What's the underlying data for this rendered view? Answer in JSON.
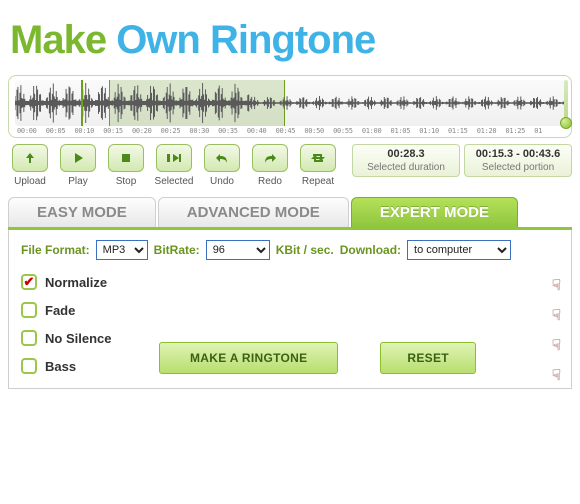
{
  "title": {
    "w1": "Make",
    "w2": "Own",
    "w3": "Ringtone"
  },
  "waveform": {
    "ticks": [
      "00:00",
      "00:05",
      "00:10",
      "00:15",
      "00:20",
      "00:25",
      "00:30",
      "00:35",
      "00:40",
      "00:45",
      "00:50",
      "00:55",
      "01:00",
      "01:05",
      "01:10",
      "01:15",
      "01:20",
      "01:25",
      "01"
    ],
    "cursor_pct": 12,
    "sel_start_pct": 17,
    "sel_end_pct": 49
  },
  "toolbar": [
    {
      "name": "upload",
      "label": "Upload",
      "icon": "upload"
    },
    {
      "name": "play",
      "label": "Play",
      "icon": "play"
    },
    {
      "name": "stop",
      "label": "Stop",
      "icon": "stop"
    },
    {
      "name": "selected",
      "label": "Selected",
      "icon": "selected"
    },
    {
      "name": "undo",
      "label": "Undo",
      "icon": "undo"
    },
    {
      "name": "redo",
      "label": "Redo",
      "icon": "redo"
    },
    {
      "name": "repeat",
      "label": "Repeat",
      "icon": "repeat"
    }
  ],
  "stats": {
    "duration": {
      "value": "00:28.3",
      "label": "Selected duration"
    },
    "portion": {
      "value": "00:15.3 - 00:43.6",
      "label": "Selected portion"
    }
  },
  "tabs": {
    "easy": "EASY MODE",
    "advanced": "ADVANCED MODE",
    "expert": "EXPERT MODE",
    "active": "expert"
  },
  "format_row": {
    "file_format_label": "File Format:",
    "file_format_value": "MP3",
    "bitrate_label": "BitRate:",
    "bitrate_value": "96",
    "bitrate_unit": "KBit / sec.",
    "download_label": "Download:",
    "download_value": "to computer"
  },
  "options": [
    {
      "key": "normalize",
      "label": "Normalize",
      "checked": true
    },
    {
      "key": "fade",
      "label": "Fade",
      "checked": false
    },
    {
      "key": "nosilence",
      "label": "No Silence",
      "checked": false
    },
    {
      "key": "bass",
      "label": "Bass",
      "checked": false
    }
  ],
  "buttons": {
    "make": "MAKE A RINGTONE",
    "reset": "RESET"
  },
  "hand_char": "☟"
}
